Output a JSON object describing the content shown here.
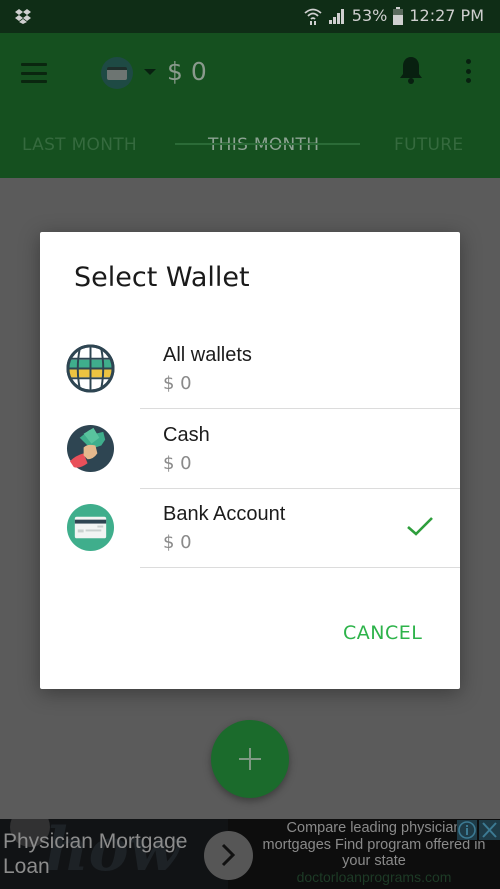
{
  "status_bar": {
    "battery": "53%",
    "time": "12:27 PM"
  },
  "app_bar": {
    "balance": "$ 0",
    "tabs": [
      {
        "label": "LAST MONTH",
        "active": false
      },
      {
        "label": "THIS MONTH",
        "active": true
      },
      {
        "label": "FUTURE",
        "active": false
      }
    ]
  },
  "dialog": {
    "title": "Select Wallet",
    "wallets": [
      {
        "name": "All wallets",
        "amount": "$ 0",
        "icon": "globe-icon",
        "selected": false
      },
      {
        "name": "Cash",
        "amount": "$ 0",
        "icon": "cash-icon",
        "selected": false
      },
      {
        "name": "Bank Account",
        "amount": "$ 0",
        "icon": "credit-card-icon",
        "selected": true
      }
    ],
    "cancel_label": "CANCEL"
  },
  "ad": {
    "title": "Physician Mortgage Loan",
    "description": "Compare leading physician mortgages Find program offered in your state",
    "url": "doctorloanprograms.com"
  },
  "colors": {
    "accent": "#2db34a",
    "app_bar": "#15501f",
    "status_bar": "#0f2d16"
  }
}
